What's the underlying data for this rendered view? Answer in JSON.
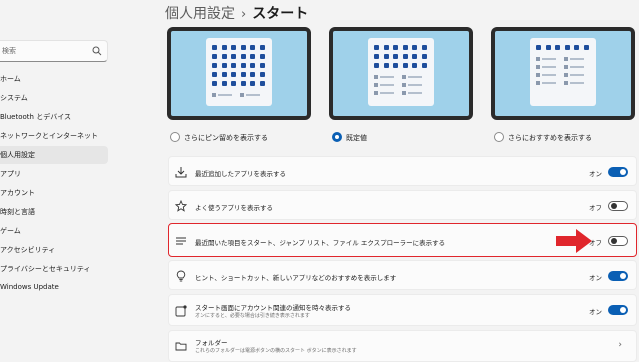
{
  "sidebar": {
    "search_placeholder": "検索",
    "items": [
      {
        "label": "ホーム"
      },
      {
        "label": "システム"
      },
      {
        "label": "Bluetooth とデバイス"
      },
      {
        "label": "ネットワークとインターネット"
      },
      {
        "label": "個人用設定",
        "active": true
      },
      {
        "label": "アプリ"
      },
      {
        "label": "アカウント"
      },
      {
        "label": "時刻と言語"
      },
      {
        "label": "ゲーム"
      },
      {
        "label": "アクセシビリティ"
      },
      {
        "label": "プライバシーとセキュリティ"
      },
      {
        "label": "Windows Update"
      }
    ]
  },
  "header": {
    "parent": "個人用設定",
    "separator": "›",
    "current": "スタート"
  },
  "layouts": [
    {
      "label": "さらにピン留めを表示する",
      "selected": false
    },
    {
      "label": "既定値",
      "selected": true
    },
    {
      "label": "さらにおすすめを表示する",
      "selected": false
    }
  ],
  "rows": [
    {
      "title": "最近追加したアプリを表示する",
      "state": "オン",
      "on": true,
      "icon": "download-icon"
    },
    {
      "title": "よく使うアプリを表示する",
      "state": "オフ",
      "on": false,
      "icon": "star-icon"
    },
    {
      "title": "最近開いた項目をスタート、ジャンプ リスト、ファイル エクスプローラーに表示する",
      "state": "オフ",
      "on": false,
      "icon": "list-icon",
      "highlighted": true
    },
    {
      "title": "ヒント、ショートカット、新しいアプリなどのおすすめを表示します",
      "state": "オン",
      "on": true,
      "icon": "lightbulb-icon"
    },
    {
      "title": "スタート画面にアカウント関連の通知を時々表示する",
      "subtitle": "オンにすると、必要な場合は引き続き表示されます",
      "state": "オン",
      "on": true,
      "icon": "notification-icon"
    },
    {
      "title": "フォルダー",
      "subtitle": "これらのフォルダーは電源ボタンの横のスタート ボタンに表示されます",
      "icon": "folder-icon",
      "chevron": "›"
    }
  ],
  "colors": {
    "accent": "#0a5fb4",
    "highlight": "#e0262c",
    "arrow": "#e0262c"
  }
}
